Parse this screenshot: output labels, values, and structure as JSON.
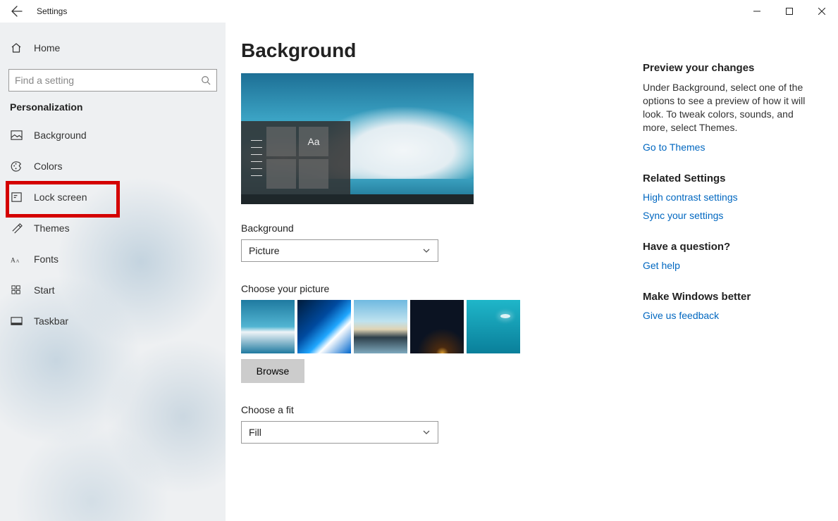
{
  "window": {
    "title": "Settings"
  },
  "sidebar": {
    "home": "Home",
    "search_placeholder": "Find a setting",
    "category": "Personalization",
    "items": [
      {
        "label": "Background"
      },
      {
        "label": "Colors"
      },
      {
        "label": "Lock screen"
      },
      {
        "label": "Themes"
      },
      {
        "label": "Fonts"
      },
      {
        "label": "Start"
      },
      {
        "label": "Taskbar"
      }
    ]
  },
  "page": {
    "title": "Background",
    "background_label": "Background",
    "background_value": "Picture",
    "choose_picture_label": "Choose your picture",
    "browse": "Browse",
    "choose_fit_label": "Choose a fit",
    "fit_value": "Fill",
    "preview_aa": "Aa"
  },
  "info": {
    "preview_heading": "Preview your changes",
    "preview_text": "Under Background, select one of the options to see a preview of how it will look. To tweak colors, sounds, and more, select Themes.",
    "go_to_themes": "Go to Themes",
    "related_heading": "Related Settings",
    "high_contrast": "High contrast settings",
    "sync": "Sync your settings",
    "question_heading": "Have a question?",
    "get_help": "Get help",
    "better_heading": "Make Windows better",
    "feedback": "Give us feedback"
  }
}
